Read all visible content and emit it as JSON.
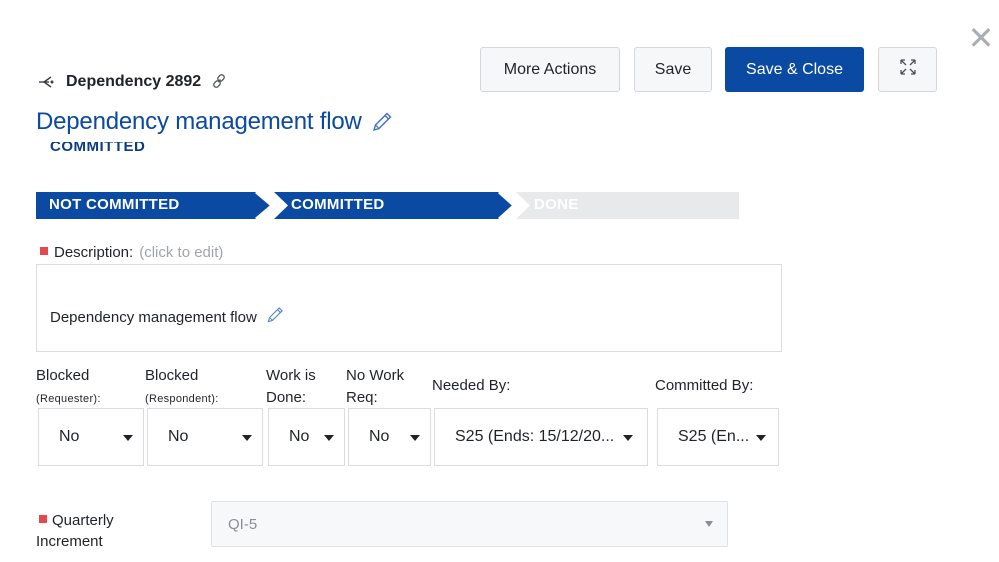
{
  "dialog": {
    "close_glyph": "✕"
  },
  "header": {
    "item_id": "Dependency 2892",
    "title": "Dependency management flow"
  },
  "toolbar": {
    "more_actions_label": "More Actions",
    "save_label": "Save",
    "save_close_label": "Save & Close"
  },
  "status": {
    "ghost_label": "COMMITTED",
    "stages": [
      {
        "label": "NOT COMMITTED",
        "state": "complete"
      },
      {
        "label": "COMMITTED",
        "state": "current"
      },
      {
        "label": "DONE",
        "state": "pending"
      }
    ]
  },
  "description": {
    "label": "Description:",
    "hint": "(click to edit)",
    "value": "Dependency management flow"
  },
  "fields": [
    {
      "label": "Blocked",
      "sublabel": "(Requester):",
      "value": "No"
    },
    {
      "label": "Blocked",
      "sublabel": "(Respondent):",
      "value": "No"
    },
    {
      "label": "Work is",
      "sublabel": "Done:",
      "value": "No"
    },
    {
      "label": "No Work",
      "sublabel": "Req:",
      "value": "No"
    },
    {
      "label": "Needed By:",
      "sublabel": "",
      "value": "S25 (Ends: 15/12/20..."
    },
    {
      "label": "Committed By:",
      "sublabel": "",
      "value": "S25 (En..."
    }
  ],
  "quarterly_increment": {
    "label_line1": "Quarterly",
    "label_line2": "Increment",
    "value": "QI-5"
  },
  "colors": {
    "brand_blue": "#0b4aa3",
    "stage_pending": "#e8e9eb",
    "required_marker": "#e5484d"
  },
  "icons": {
    "dependency": "dependency-icon",
    "link": "link-icon",
    "edit": "pencil-icon",
    "expand": "expand-icon",
    "close": "close-icon"
  }
}
